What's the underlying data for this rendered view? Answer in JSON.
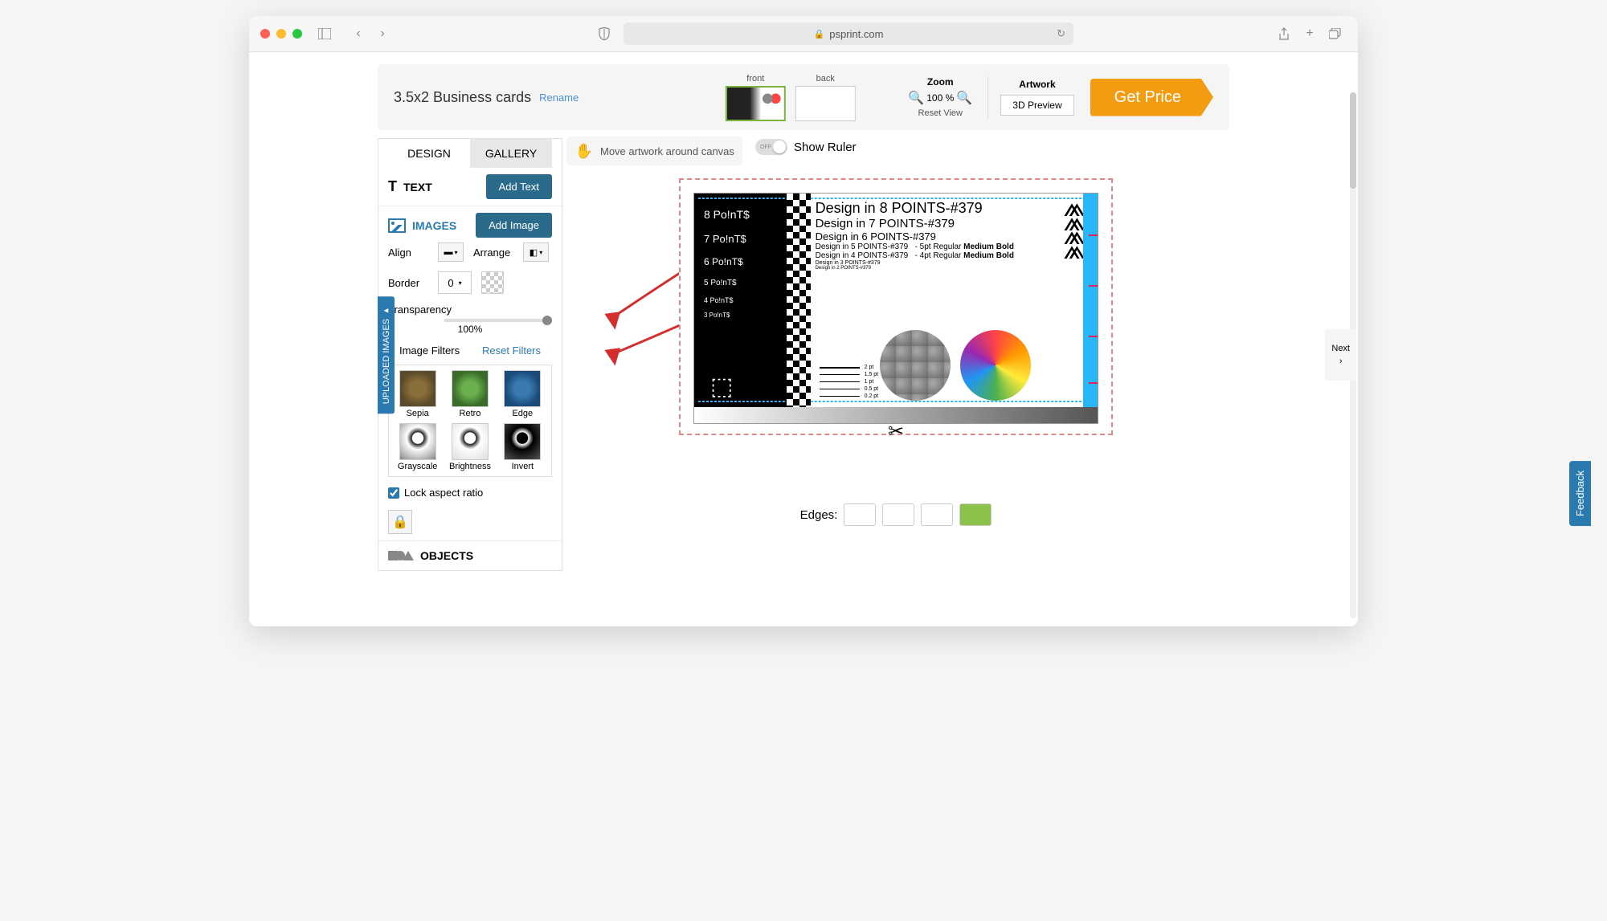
{
  "browser": {
    "url": "psprint.com"
  },
  "header": {
    "product_title": "3.5x2 Business cards",
    "rename": "Rename",
    "sides": {
      "front": "front",
      "back": "back"
    },
    "zoom": {
      "label": "Zoom",
      "value": "100 %",
      "reset": "Reset View"
    },
    "artwork": {
      "label": "Artwork",
      "preview_3d": "3D Preview"
    },
    "get_price": "Get Price"
  },
  "toolbar": {
    "move_hint": "Move artwork around canvas",
    "ruler_label": "Show Ruler",
    "ruler_state": "OFF"
  },
  "tabs": {
    "design": "DESIGN",
    "gallery": "GALLERY"
  },
  "panel": {
    "text": {
      "label": "TEXT",
      "add": "Add Text"
    },
    "images": {
      "label": "IMAGES",
      "add": "Add Image"
    },
    "align_label": "Align",
    "arrange_label": "Arrange",
    "border_label": "Border",
    "border_value": "0",
    "transparency_label": "Transparency",
    "transparency_value": "100%",
    "filters_label": "Image Filters",
    "reset_filters": "Reset Filters",
    "filters": {
      "sepia": "Sepia",
      "retro": "Retro",
      "edge": "Edge",
      "grayscale": "Grayscale",
      "brightness": "Brightness",
      "invert": "Invert"
    },
    "lock_aspect": "Lock aspect ratio",
    "objects_label": "OBJECTS"
  },
  "canvas": {
    "left_points": [
      "8 Po!nT$",
      "7 Po!nT$",
      "6 Po!nT$",
      "5 Po!nT$",
      "4 Po!nT$",
      "3 Po!nT$"
    ],
    "right_lines": {
      "l1": "Design in 8 POINTS-#379",
      "l2": "Design in 7 POINTS-#379",
      "l3": "Design in 6 POINTS-#379",
      "l4": "Design in 5 POINTS-#379",
      "l4b": "- 5pt Regular",
      "l4m": "Medium",
      "l4bd": "Bold",
      "l5": "Design in 4 POINTS-#379",
      "l5b": "- 4pt Regular",
      "l5m": "Medium",
      "l5bd": "Bold",
      "l6": "Design in 3 POINTS-#379",
      "l7": "Design in 2 POINTS-#379"
    },
    "line_weights": [
      "2 pt",
      "1.5 pt",
      "1 pt",
      "0.5 pt",
      "0.2 pt"
    ],
    "edges_label": "Edges:"
  },
  "side_tabs": {
    "uploaded": "UPLOADED IMAGES ▸",
    "next": "Next",
    "feedback": "Feedback"
  }
}
